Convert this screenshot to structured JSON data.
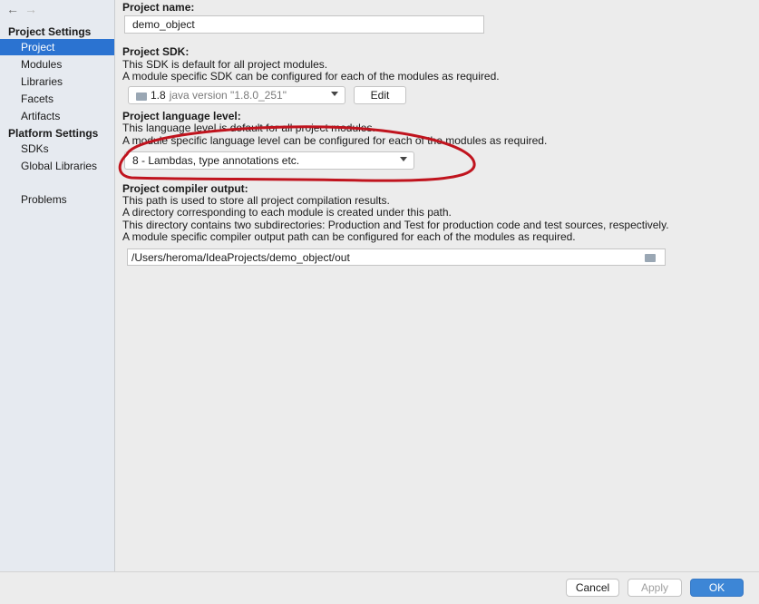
{
  "sidebar": {
    "nav_back": "←",
    "nav_forward": "→",
    "project_settings_header": "Project Settings",
    "project_settings_items": [
      "Project",
      "Modules",
      "Libraries",
      "Facets",
      "Artifacts"
    ],
    "selected_item": "Project",
    "platform_settings_header": "Platform Settings",
    "platform_settings_items": [
      "SDKs",
      "Global Libraries"
    ],
    "problems": "Problems"
  },
  "project_name": {
    "label": "Project name:",
    "value": "demo_object"
  },
  "project_sdk": {
    "label": "Project SDK:",
    "desc1": "This SDK is default for all project modules.",
    "desc2": "A module specific SDK can be configured for each of the modules as required.",
    "selected_name": "1.8",
    "selected_version": "java version \"1.8.0_251\"",
    "edit_button": "Edit"
  },
  "language_level": {
    "label": "Project language level:",
    "desc1": "This language level is default for all project modules.",
    "desc2": "A module specific language level can be configured for each of the modules as required.",
    "selected": "8 - Lambdas, type annotations etc."
  },
  "compiler_output": {
    "label": "Project compiler output:",
    "desc1": "This path is used to store all project compilation results.",
    "desc2": "A directory corresponding to each module is created under this path.",
    "desc3": "This directory contains two subdirectories: Production and Test for production code and test sources, respectively.",
    "desc4": "A module specific compiler output path can be configured for each of the modules as required.",
    "value": "/Users/heroma/IdeaProjects/demo_object/out"
  },
  "buttons": {
    "cancel": "Cancel",
    "apply": "Apply",
    "ok": "OK"
  },
  "colors": {
    "selection": "#2b73d1",
    "primary_button": "#3d86d6",
    "annotation": "#c0141e"
  }
}
